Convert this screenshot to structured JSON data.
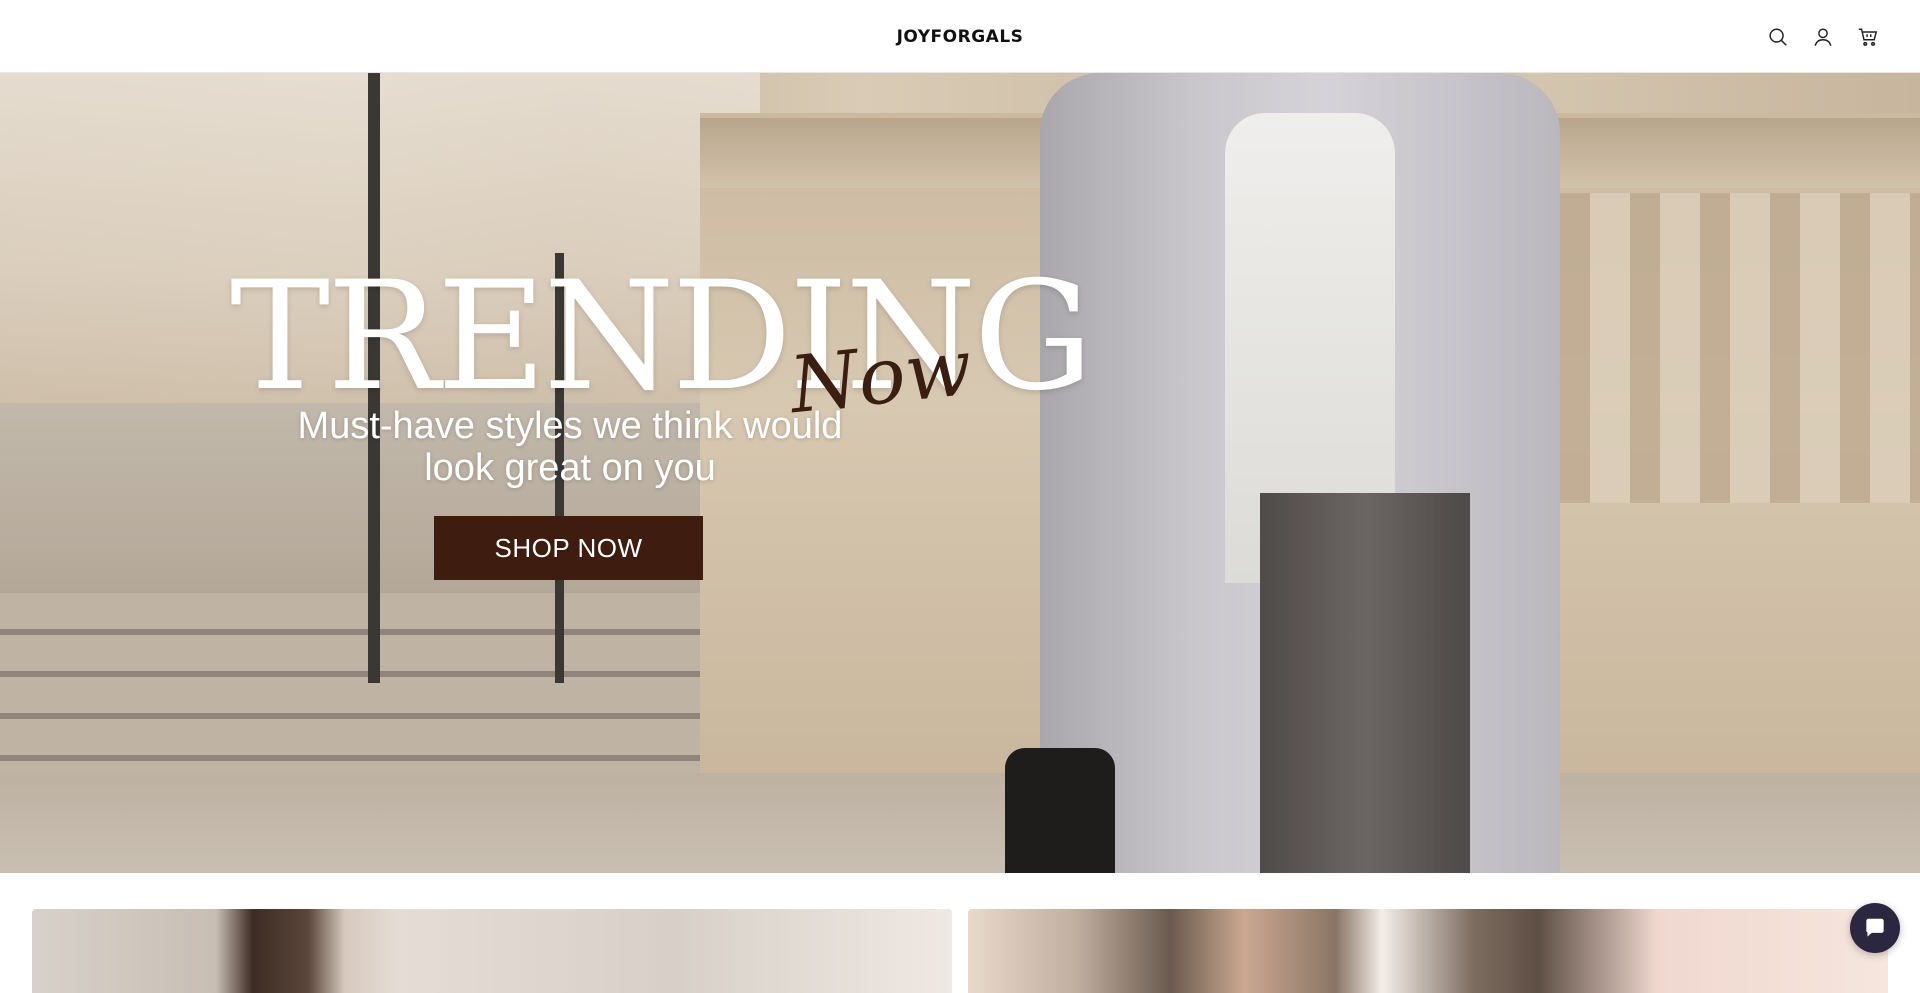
{
  "header": {
    "logo_text": "JOYFORGALS",
    "icons": [
      "search-icon",
      "account-icon",
      "cart-icon"
    ]
  },
  "hero": {
    "headline": "TRENDING",
    "headline_accent": "Now",
    "subtitle": "Must-have styles we think would look great on you",
    "cta_label": "SHOP NOW",
    "colors": {
      "cta_background": "#3e1c10",
      "accent_text": "#3a1e12",
      "headline_text": "#ffffff"
    }
  },
  "chat": {
    "icon": "chat-bubble-icon",
    "color": "#2c2740"
  }
}
